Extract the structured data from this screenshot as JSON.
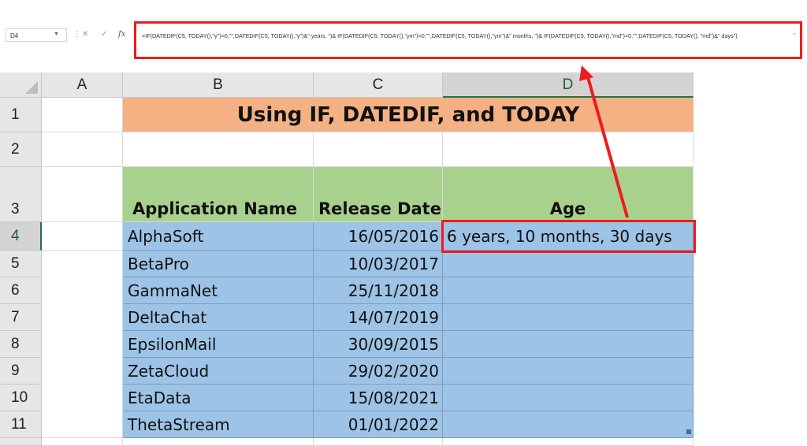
{
  "formula_bar": {
    "name_box": "D4",
    "fx_label": "fx",
    "formula": "=IF(DATEDIF(C5, TODAY(),\"y\")=0,\"\",DATEDIF(C5, TODAY(),\"y\")&\" years, \")& IF(DATEDIF(C5, TODAY(),\"ym\")=0,\"\",DATEDIF(C5, TODAY(),\"ym\")&\" months, \")& IF(DATEDIF(C5, TODAY(),\"md\")=0,\"\",DATEDIF(C5, TODAY(), \"md\")&\" days\")"
  },
  "columns": [
    "A",
    "B",
    "C",
    "D"
  ],
  "rows": [
    "1",
    "2",
    "3",
    "4",
    "5",
    "6",
    "7",
    "8",
    "9",
    "10",
    "11"
  ],
  "sheet": {
    "title": "Using IF, DATEDIF, and TODAY",
    "headers": {
      "app": "Application Name",
      "date": "Release Date",
      "age": "Age"
    },
    "records": [
      {
        "app": "AlphaSoft",
        "date": "16/05/2016",
        "age": "6 years, 10 months, 30 days"
      },
      {
        "app": "BetaPro",
        "date": "10/03/2017",
        "age": ""
      },
      {
        "app": "GammaNet",
        "date": "25/11/2018",
        "age": ""
      },
      {
        "app": "DeltaChat",
        "date": "14/07/2019",
        "age": ""
      },
      {
        "app": "EpsilonMail",
        "date": "30/09/2015",
        "age": ""
      },
      {
        "app": "ZetaCloud",
        "date": "29/02/2020",
        "age": ""
      },
      {
        "app": "EtaData",
        "date": "15/08/2021",
        "age": ""
      },
      {
        "app": "ThetaStream",
        "date": "01/01/2022",
        "age": ""
      }
    ]
  },
  "colors": {
    "title_fill": "#f4b183",
    "header_fill": "#a9d18e",
    "data_fill": "#9dc3e6",
    "highlight": "#ee1c1c",
    "selection": "#217346"
  }
}
